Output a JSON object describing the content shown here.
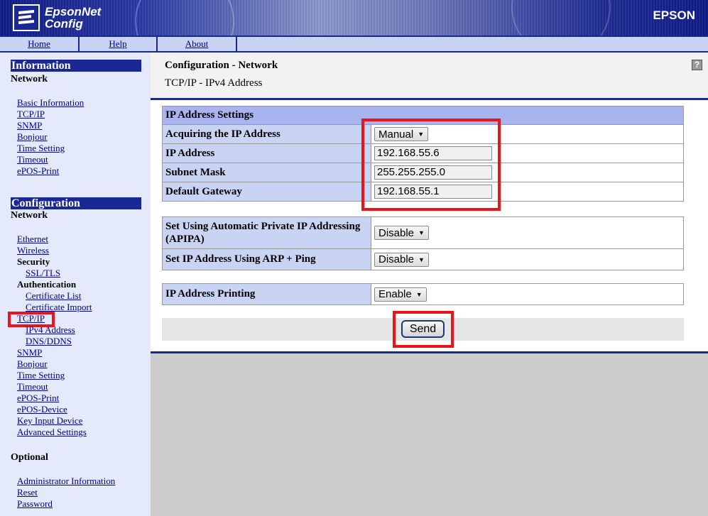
{
  "header": {
    "app_name_line1": "EpsonNet",
    "app_name_line2": "Config",
    "brand": "EPSON"
  },
  "nav": {
    "home": "Home",
    "help": "Help",
    "about": "About"
  },
  "sidebar": {
    "info_heading": "Information",
    "info_sub": "Network",
    "info_links": [
      "Basic Information",
      "TCP/IP",
      "SNMP",
      "Bonjour",
      "Time Setting",
      "Timeout",
      "ePOS-Print"
    ],
    "config_heading": "Configuration",
    "config_sub": "Network",
    "config_items": {
      "ethernet": "Ethernet",
      "wireless": "Wireless",
      "security": "Security",
      "ssl_tls": "SSL/TLS",
      "authentication": "Authentication",
      "certificate_list": "Certificate List",
      "certificate_import": "Certificate Import",
      "tcpip": "TCP/IP",
      "ipv4": "IPv4 Address",
      "dns": "DNS/DDNS",
      "snmp": "SNMP",
      "bonjour": "Bonjour",
      "time_setting": "Time Setting",
      "timeout": "Timeout",
      "epos_print": "ePOS-Print",
      "epos_device": "ePOS-Device",
      "key_input": "Key Input Device",
      "advanced": "Advanced Settings"
    },
    "optional_heading": "Optional",
    "optional_links": [
      "Administrator Information",
      "Reset",
      "Password"
    ]
  },
  "main": {
    "title": "Configuration - Network",
    "subtitle": "TCP/IP - IPv4 Address",
    "help_icon": "?",
    "ip_settings": {
      "header": "IP Address Settings",
      "acquire_label": "Acquiring the IP Address",
      "acquire_value": "Manual",
      "ip_label": "IP Address",
      "ip_value": "192.168.55.6",
      "subnet_label": "Subnet Mask",
      "subnet_value": "255.255.255.0",
      "gateway_label": "Default Gateway",
      "gateway_value": "192.168.55.1"
    },
    "apipa_label": "Set Using Automatic Private IP Addressing (APIPA)",
    "apipa_value": "Disable",
    "arp_label": "Set IP Address Using ARP + Ping",
    "arp_value": "Disable",
    "printing_label": "IP Address Printing",
    "printing_value": "Enable",
    "send_label": "Send"
  },
  "colors": {
    "navy": "#1a2893",
    "label_bg": "#c9d3f4",
    "header_bg": "#a9b4ef",
    "highlight": "#e8161b"
  }
}
